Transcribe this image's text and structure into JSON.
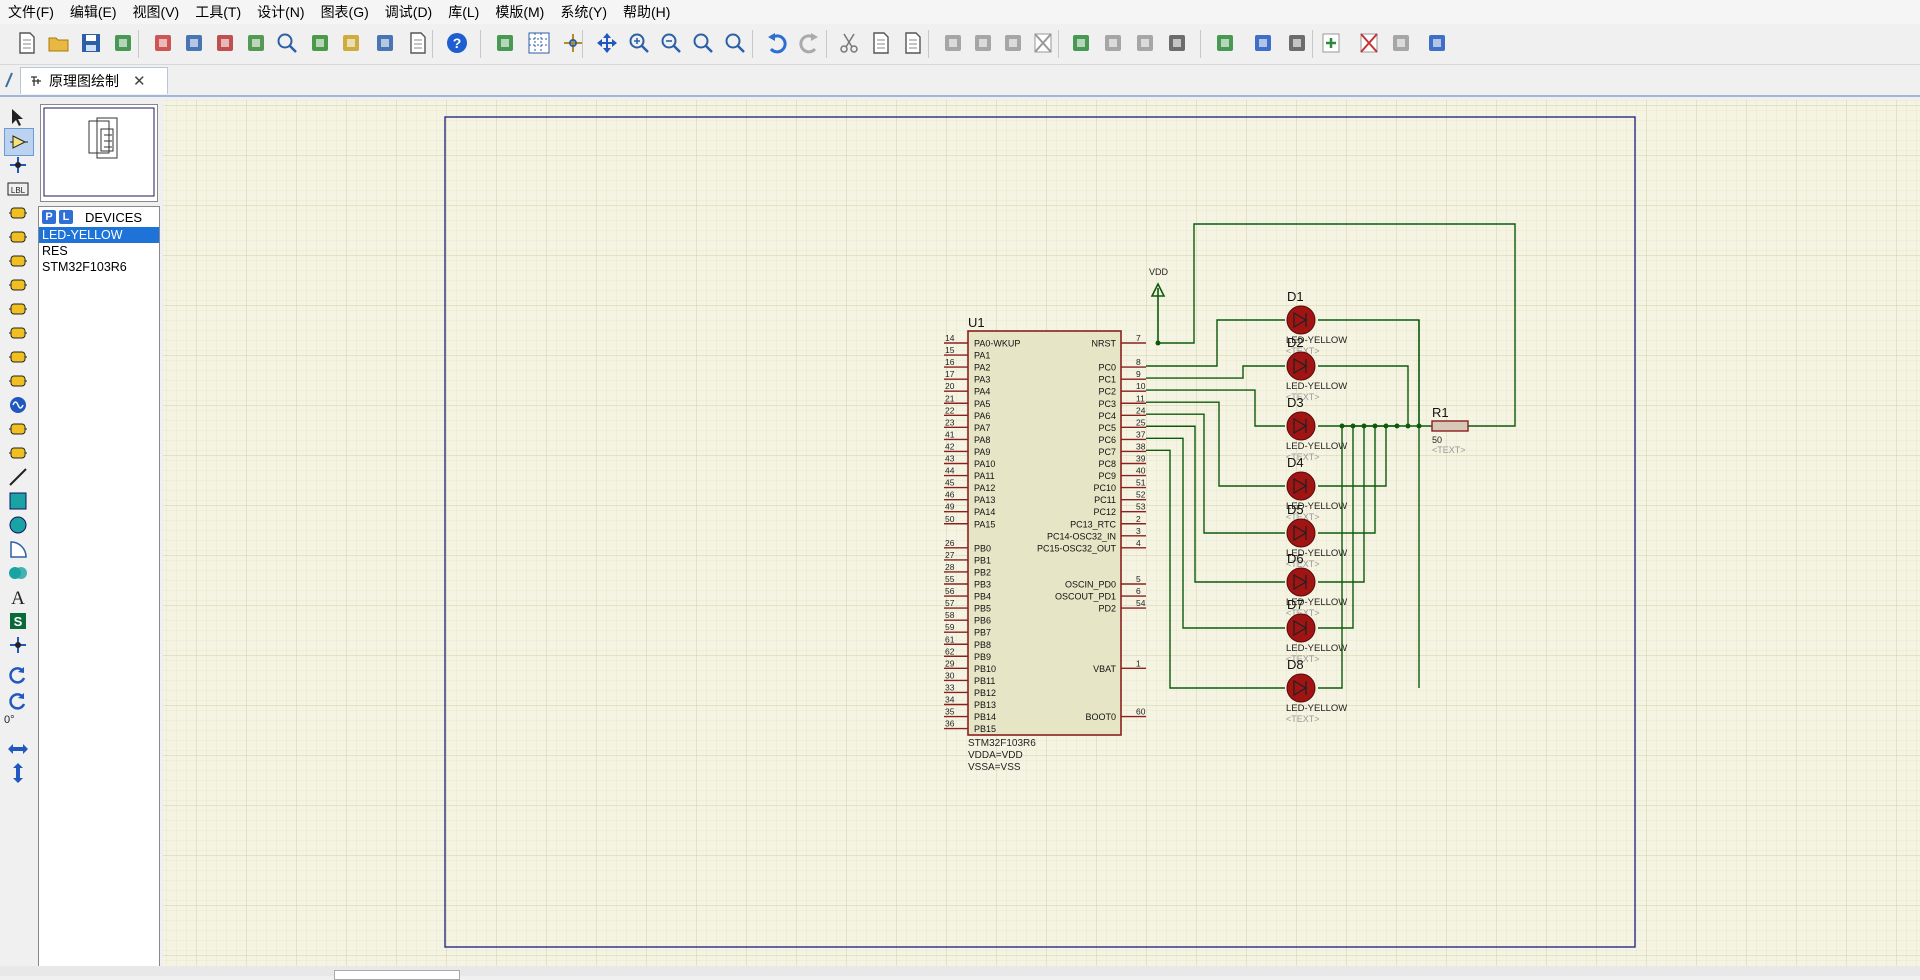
{
  "menu": [
    "文件(F)",
    "编辑(E)",
    "视图(V)",
    "工具(T)",
    "设计(N)",
    "图表(G)",
    "调试(D)",
    "库(L)",
    "模版(M)",
    "系统(Y)",
    "帮助(H)"
  ],
  "tab": {
    "title": "原理图绘制",
    "close": "✕"
  },
  "devices": {
    "p_btn": "P",
    "l_btn": "L",
    "header": "DEVICES",
    "items": [
      {
        "label": "LED-YELLOW",
        "selected": true
      },
      {
        "label": "RES",
        "selected": false
      },
      {
        "label": "STM32F103R6",
        "selected": false
      }
    ]
  },
  "rotation": "0°",
  "colors": {
    "grid_bg": "#f5f4e2",
    "wire": "#0d5a0d",
    "chip_fill": "#e6e6c6",
    "chip_border": "#8a2020",
    "led": "#a01414",
    "border": "#2a2a88",
    "selected": "#1e73d8"
  },
  "schematic": {
    "chip": {
      "ref": "U1",
      "part": "STM32F103R6",
      "props": [
        "VDDA=VDD",
        "VSSA=VSS"
      ],
      "left_pins": [
        {
          "n": "14",
          "name": "PA0-WKUP"
        },
        {
          "n": "15",
          "name": "PA1"
        },
        {
          "n": "16",
          "name": "PA2"
        },
        {
          "n": "17",
          "name": "PA3"
        },
        {
          "n": "20",
          "name": "PA4"
        },
        {
          "n": "21",
          "name": "PA5"
        },
        {
          "n": "22",
          "name": "PA6"
        },
        {
          "n": "23",
          "name": "PA7"
        },
        {
          "n": "41",
          "name": "PA8"
        },
        {
          "n": "42",
          "name": "PA9"
        },
        {
          "n": "43",
          "name": "PA10"
        },
        {
          "n": "44",
          "name": "PA11"
        },
        {
          "n": "45",
          "name": "PA12"
        },
        {
          "n": "46",
          "name": "PA13"
        },
        {
          "n": "49",
          "name": "PA14"
        },
        {
          "n": "50",
          "name": "PA15"
        },
        {
          "n": "",
          "name": ""
        },
        {
          "n": "26",
          "name": "PB0"
        },
        {
          "n": "27",
          "name": "PB1"
        },
        {
          "n": "28",
          "name": "PB2"
        },
        {
          "n": "55",
          "name": "PB3"
        },
        {
          "n": "56",
          "name": "PB4"
        },
        {
          "n": "57",
          "name": "PB5"
        },
        {
          "n": "58",
          "name": "PB6"
        },
        {
          "n": "59",
          "name": "PB7"
        },
        {
          "n": "61",
          "name": "PB8"
        },
        {
          "n": "62",
          "name": "PB9"
        },
        {
          "n": "29",
          "name": "PB10"
        },
        {
          "n": "30",
          "name": "PB11"
        },
        {
          "n": "33",
          "name": "PB12"
        },
        {
          "n": "34",
          "name": "PB13"
        },
        {
          "n": "35",
          "name": "PB14"
        },
        {
          "n": "36",
          "name": "PB15"
        }
      ],
      "right_pins": [
        {
          "n": "7",
          "name": "NRST"
        },
        {
          "n": "",
          "name": ""
        },
        {
          "n": "8",
          "name": "PC0"
        },
        {
          "n": "9",
          "name": "PC1"
        },
        {
          "n": "10",
          "name": "PC2"
        },
        {
          "n": "11",
          "name": "PC3"
        },
        {
          "n": "24",
          "name": "PC4"
        },
        {
          "n": "25",
          "name": "PC5"
        },
        {
          "n": "37",
          "name": "PC6"
        },
        {
          "n": "38",
          "name": "PC7"
        },
        {
          "n": "39",
          "name": "PC8"
        },
        {
          "n": "40",
          "name": "PC9"
        },
        {
          "n": "51",
          "name": "PC10"
        },
        {
          "n": "52",
          "name": "PC11"
        },
        {
          "n": "53",
          "name": "PC12"
        },
        {
          "n": "2",
          "name": "PC13_RTC"
        },
        {
          "n": "3",
          "name": "PC14-OSC32_IN"
        },
        {
          "n": "4",
          "name": "PC15-OSC32_OUT"
        },
        {
          "n": "",
          "name": ""
        },
        {
          "n": "",
          "name": ""
        },
        {
          "n": "5",
          "name": "OSCIN_PD0"
        },
        {
          "n": "6",
          "name": "OSCOUT_PD1"
        },
        {
          "n": "54",
          "name": "PD2"
        },
        {
          "n": "",
          "name": ""
        },
        {
          "n": "",
          "name": ""
        },
        {
          "n": "",
          "name": ""
        },
        {
          "n": "",
          "name": ""
        },
        {
          "n": "1",
          "name": "VBAT"
        },
        {
          "n": "",
          "name": ""
        },
        {
          "n": "",
          "name": ""
        },
        {
          "n": "",
          "name": ""
        },
        {
          "n": "60",
          "name": "BOOT0"
        }
      ]
    },
    "vdd_label": "VDD",
    "leds": [
      {
        "ref": "D1",
        "part": "LED-YELLOW",
        "text": "<TEXT>"
      },
      {
        "ref": "D2",
        "part": "LED-YELLOW",
        "text": "<TEXT>"
      },
      {
        "ref": "D3",
        "part": "LED-YELLOW",
        "text": "<TEXT>"
      },
      {
        "ref": "D4",
        "part": "LED-YELLOW",
        "text": "<TEXT>"
      },
      {
        "ref": "D5",
        "part": "LED-YELLOW",
        "text": "<TEXT>"
      },
      {
        "ref": "D6",
        "part": "LED-YELLOW",
        "text": "<TEXT>"
      },
      {
        "ref": "D7",
        "part": "LED-YELLOW",
        "text": "<TEXT>"
      },
      {
        "ref": "D8",
        "part": "LED-YELLOW",
        "text": "<TEXT>"
      }
    ],
    "resistor": {
      "ref": "R1",
      "value": "50",
      "text": "<TEXT>"
    }
  },
  "toolbar_icons": [
    "new-file-icon",
    "open-folder-icon",
    "save-icon",
    "import-icon",
    "home-icon",
    "component-icon",
    "chip-icon",
    "layout-icon",
    "search-icon",
    "pcb-icon",
    "bom-icon",
    "binary-icon",
    "document-icon",
    "help-icon",
    "refresh-icon",
    "grid-icon",
    "origin-icon",
    "pan-icon",
    "zoom-in-icon",
    "zoom-out-icon",
    "zoom-all-icon",
    "zoom-area-icon",
    "undo-icon",
    "redo-icon",
    "cut-icon",
    "copy-icon",
    "paste-icon",
    "block-copy-icon",
    "block-move-icon",
    "block-rotate-icon",
    "block-delete-icon",
    "pick-device-icon",
    "make-device-icon",
    "package-icon",
    "decompose-icon",
    "wire-autoroute-icon",
    "search-tag-icon",
    "property-icon",
    "new-sheet-icon",
    "delete-sheet-icon",
    "netlist-icon",
    "design-explorer-icon"
  ],
  "left_tool_icons": [
    "select-mode-icon",
    "component-mode-icon",
    "junction-icon",
    "wire-label-icon",
    "text-script-icon",
    "bus-icon",
    "subcircuit-icon",
    "terminal-icon",
    "port-icon",
    "probe-icon",
    "graph-icon",
    "tape-icon",
    "generator-icon",
    "voltage-probe-icon",
    "current-probe-icon",
    "line-icon",
    "box-icon",
    "circle-icon",
    "arc-icon",
    "path-icon",
    "text-icon",
    "symbol-icon",
    "marker-icon",
    "rotate-cw-icon",
    "rotate-ccw-icon",
    "flip-h-icon",
    "flip-v-icon"
  ]
}
